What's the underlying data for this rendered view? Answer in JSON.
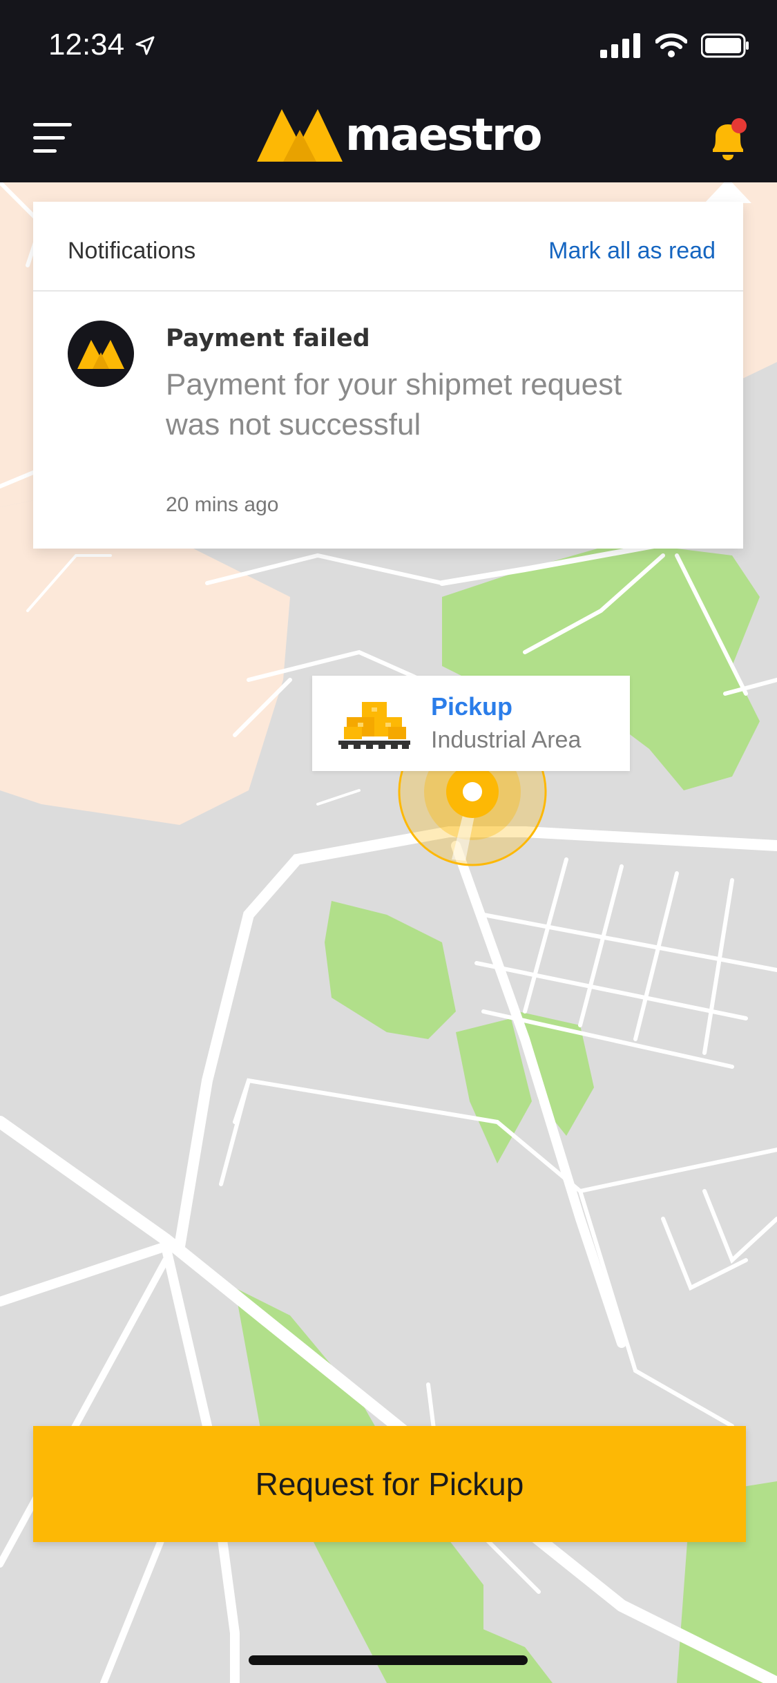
{
  "status_bar": {
    "time": "12:34"
  },
  "header": {
    "logo_text": "maestro",
    "brand_color": "#FDB805",
    "icons": [
      "menu-icon",
      "bell-icon"
    ]
  },
  "notifications": {
    "title": "Notifications",
    "mark_all_label": "Mark all as read",
    "items": [
      {
        "title": "Payment failed",
        "body": "Payment for your shipmet request was not successful",
        "time": "20 mins ago"
      }
    ]
  },
  "pickup": {
    "label": "Pickup",
    "location": "Industrial Area"
  },
  "actions": {
    "request_label": "Request for Pickup"
  },
  "colors": {
    "header_bg": "#15151B",
    "accent": "#FDB805",
    "link": "#1565C0",
    "pickup_label": "#2B7DE9",
    "notification_dot": "#E53935",
    "map_bg": "#DCDCDC",
    "park": "#B1DF8A",
    "residential": "#FCE8D9"
  }
}
